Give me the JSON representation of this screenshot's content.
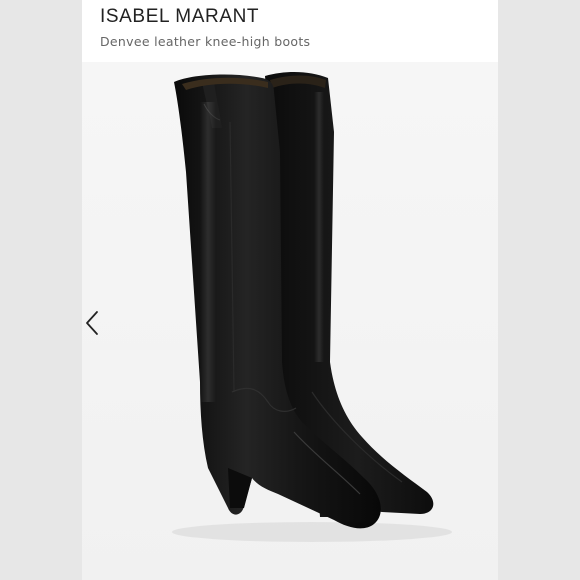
{
  "product": {
    "brand": "ISABEL MARANT",
    "name": "Denvee leather knee-high boots"
  },
  "gallery": {
    "image_alt": "Denvee leather knee-high boots",
    "prev_icon": "chevron-left-icon",
    "prev_label": "Previous image"
  },
  "colors": {
    "side_strip": "#e7e7e7",
    "image_bg": "#f4f4f4",
    "leather": "#141414",
    "brand_text": "#222222",
    "subtitle_text": "#666666"
  }
}
